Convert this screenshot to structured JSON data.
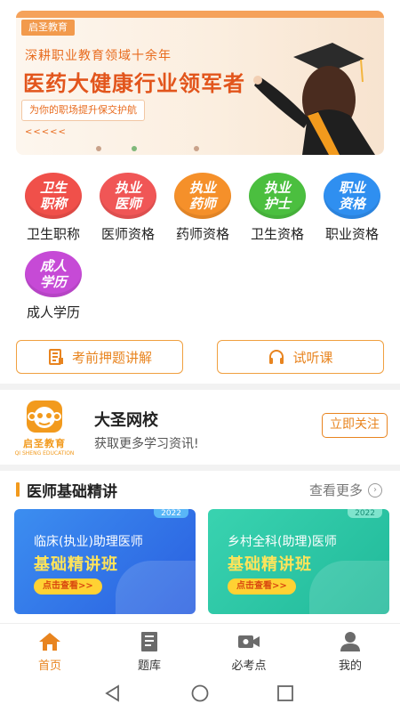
{
  "banner": {
    "brand": "启圣教育",
    "line1": "深耕职业教育领域十余年",
    "line2": "医药大健康行业领军者",
    "line3": "为你的职场提升保交护航",
    "arrows": "<<<<<"
  },
  "categories": [
    {
      "icon_text": "卫生职称",
      "label": "卫生职称",
      "color": "#f0504a"
    },
    {
      "icon_text": "执业医师",
      "label": "医师资格",
      "color": "#f05656"
    },
    {
      "icon_text": "执业药师",
      "label": "药师资格",
      "color": "#f5902a"
    },
    {
      "icon_text": "执业护士",
      "label": "卫生资格",
      "color": "#4bbf3f"
    },
    {
      "icon_text": "职业资格",
      "label": "职业资格",
      "color": "#2f8ff0"
    },
    {
      "icon_text": "成人学历",
      "label": "成人学历",
      "color": "#c64ad6"
    }
  ],
  "actions": {
    "exam_tips": "考前押题讲解",
    "trial_class": "试听课"
  },
  "school": {
    "logo_text": "启圣教育",
    "logo_sub": "QI SHENG EDUCATION",
    "name": "大圣网校",
    "subtitle": "获取更多学习资讯!",
    "follow": "立即关注"
  },
  "section": {
    "title": "医师基础精讲",
    "more": "查看更多"
  },
  "courses": [
    {
      "year": "2022",
      "line1": "临床(执业)助理医师",
      "line2": "基础精讲班",
      "cta": "点击查看>>"
    },
    {
      "year": "2022",
      "line1": "乡村全科(助理)医师",
      "line2": "基础精讲班",
      "cta": "点击查看>>"
    }
  ],
  "nav": [
    {
      "label": "首页",
      "icon": "home-icon",
      "active": true
    },
    {
      "label": "题库",
      "icon": "book-icon",
      "active": false
    },
    {
      "label": "必考点",
      "icon": "video-icon",
      "active": false
    },
    {
      "label": "我的",
      "icon": "user-icon",
      "active": false
    }
  ],
  "colors": {
    "accent": "#e8841f",
    "brand_orange": "#f29a1d"
  }
}
